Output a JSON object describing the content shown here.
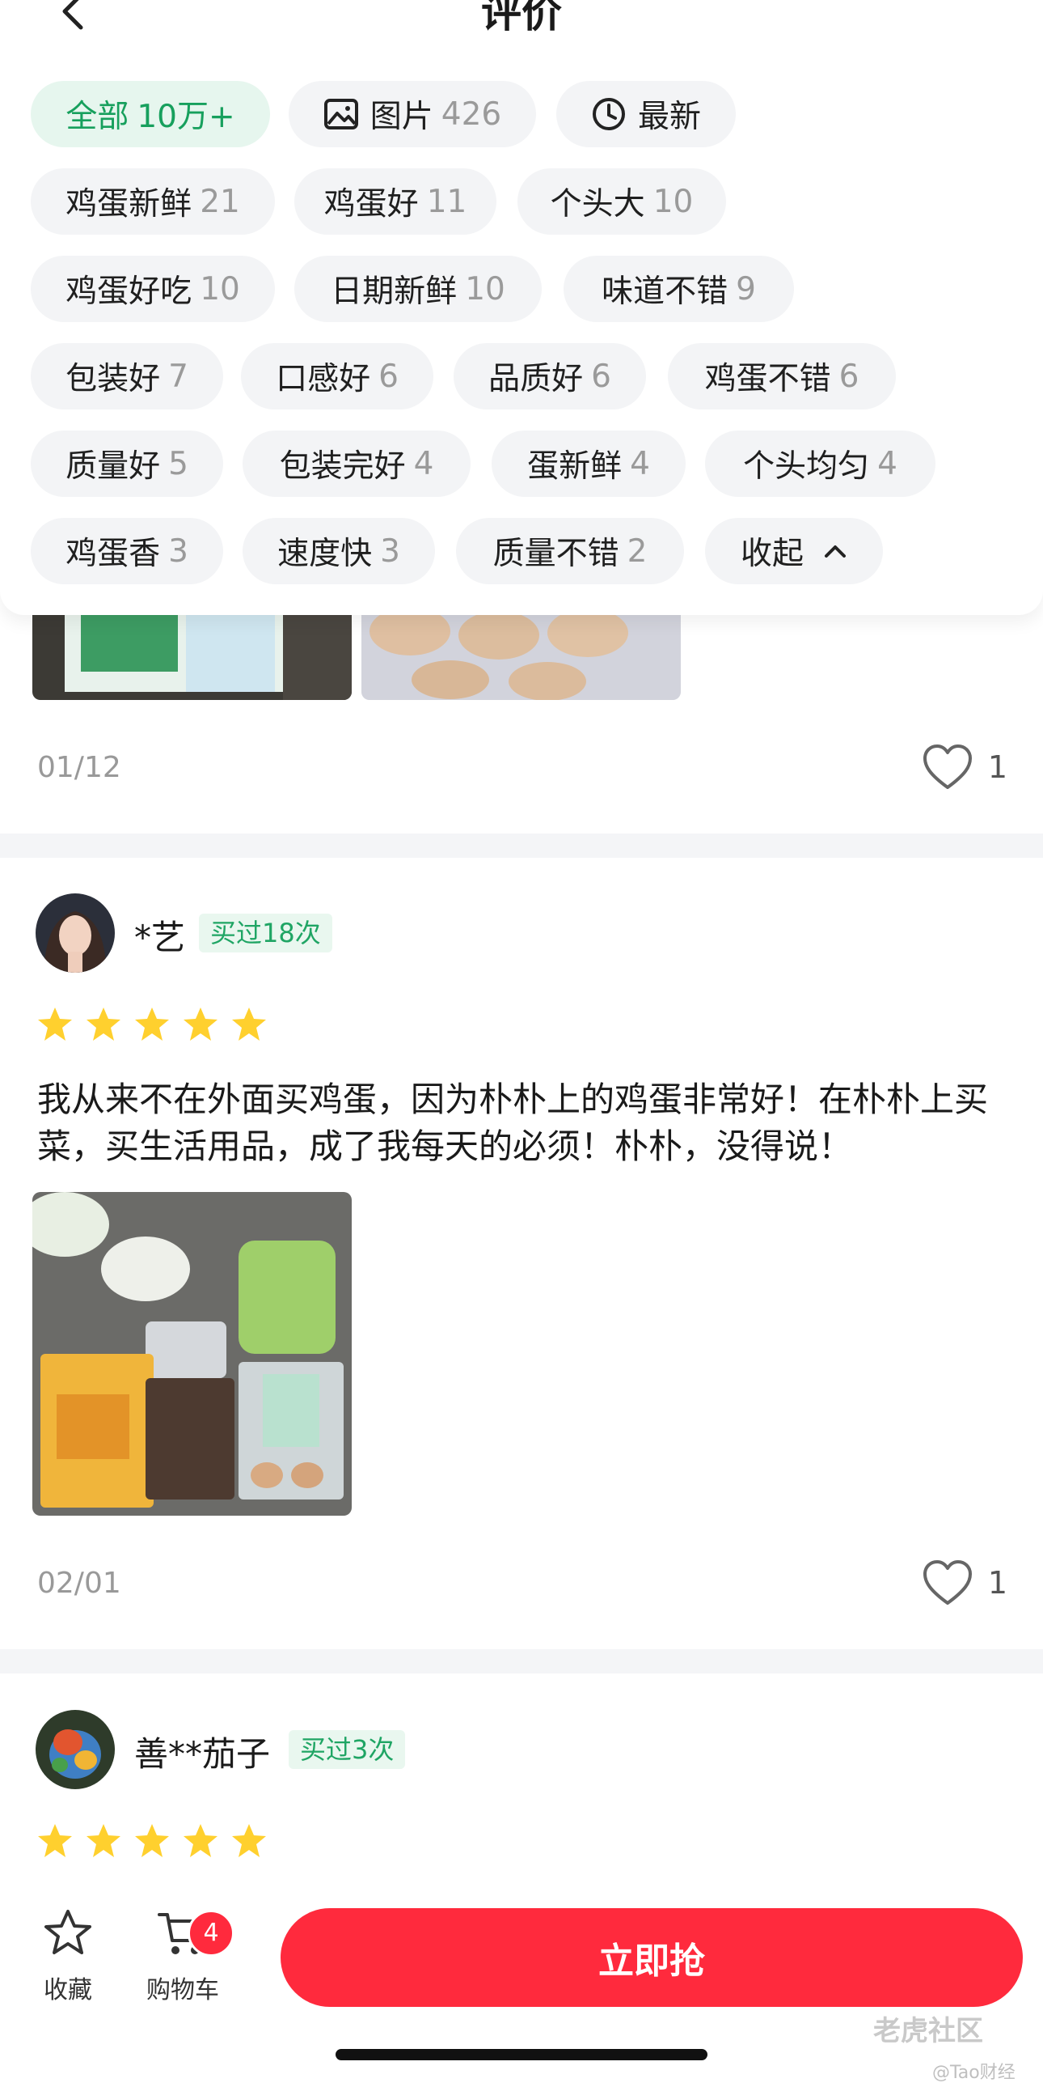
{
  "header": {
    "title": "评价"
  },
  "filters": {
    "all": {
      "label": "全部",
      "count": "10万+"
    },
    "images": {
      "label": "图片",
      "count": "426"
    },
    "latest": {
      "label": "最新"
    },
    "tags": [
      {
        "label": "鸡蛋新鲜",
        "count": "21"
      },
      {
        "label": "鸡蛋好",
        "count": "11"
      },
      {
        "label": "个头大",
        "count": "10"
      },
      {
        "label": "鸡蛋好吃",
        "count": "10"
      },
      {
        "label": "日期新鲜",
        "count": "10"
      },
      {
        "label": "味道不错",
        "count": "9"
      },
      {
        "label": "包装好",
        "count": "7"
      },
      {
        "label": "口感好",
        "count": "6"
      },
      {
        "label": "品质好",
        "count": "6"
      },
      {
        "label": "鸡蛋不错",
        "count": "6"
      },
      {
        "label": "质量好",
        "count": "5"
      },
      {
        "label": "包装完好",
        "count": "4"
      },
      {
        "label": "蛋新鲜",
        "count": "4"
      },
      {
        "label": "个头均匀",
        "count": "4"
      },
      {
        "label": "鸡蛋香",
        "count": "3"
      },
      {
        "label": "速度快",
        "count": "3"
      },
      {
        "label": "质量不错",
        "count": "2"
      }
    ],
    "collapse_label": "收起"
  },
  "reviews": [
    {
      "date": "01/12",
      "likes": "1"
    },
    {
      "username": "*艺",
      "badge": "买过18次",
      "rating": 5,
      "text": "我从来不在外面买鸡蛋，因为朴朴上的鸡蛋非常好！在朴朴上买菜，买生活用品，成了我每天的必须！朴朴，没得说！",
      "date": "02/01",
      "likes": "1"
    },
    {
      "username": "善**茄子",
      "badge": "买过3次",
      "rating": 5
    }
  ],
  "bottom_bar": {
    "favorite_label": "收藏",
    "cart_label": "购物车",
    "cart_count": "4",
    "buy_label": "立即抢"
  },
  "watermark": {
    "main": "老虎社区",
    "sub": "@Tao财经"
  },
  "colors": {
    "accent_green": "#17a05d",
    "brand_red": "#ff2a3d"
  }
}
